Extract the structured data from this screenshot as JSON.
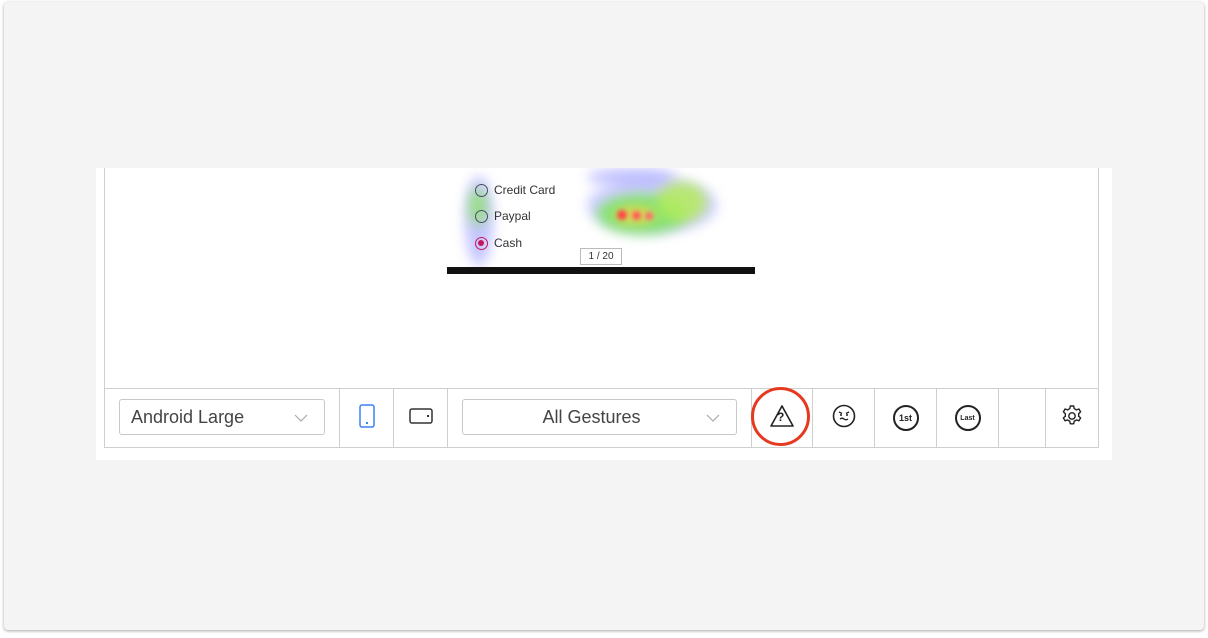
{
  "screenshot": {
    "options": [
      {
        "label": "Credit Card",
        "selected": false
      },
      {
        "label": "Paypal",
        "selected": false
      },
      {
        "label": "Cash",
        "selected": true
      }
    ],
    "pager": "1 / 20"
  },
  "toolbar": {
    "device_select": "Android Large",
    "gesture_select": "All Gestures",
    "tools": [
      {
        "name": "unknown-gesture-icon",
        "label": "?"
      },
      {
        "name": "frustration-icon",
        "label": ""
      },
      {
        "name": "first-touch-icon",
        "label": "1st"
      },
      {
        "name": "last-touch-icon",
        "label": "Last"
      }
    ]
  },
  "colors": {
    "accent": "#3b82f6",
    "highlight": "#e53a20",
    "selected_radio": "#c2185b"
  }
}
